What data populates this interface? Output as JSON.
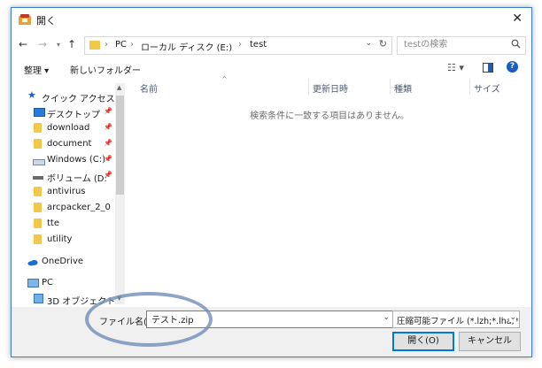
{
  "window": {
    "title": "開く",
    "close_icon": "close-icon"
  },
  "address": {
    "crumbs": [
      "PC",
      "ローカル ディスク (E:)",
      "test"
    ],
    "separator": "›"
  },
  "search": {
    "placeholder": "testの検索"
  },
  "toolbar": {
    "organize": "整理 ▾",
    "new_folder": "新しいフォルダー"
  },
  "sidebar": {
    "quick_access": "クイック アクセス",
    "items": [
      {
        "label": "デスクトップ",
        "pinned": true
      },
      {
        "label": "download",
        "pinned": true
      },
      {
        "label": "document",
        "pinned": true
      },
      {
        "label": "Windows (C:)",
        "pinned": true
      },
      {
        "label": "ボリューム (D:",
        "pinned": true
      },
      {
        "label": "antivirus"
      },
      {
        "label": "arcpacker_2_0"
      },
      {
        "label": "tte"
      },
      {
        "label": "utility"
      }
    ],
    "onedrive": "OneDrive",
    "pc": "PC",
    "objects3d": "3D オブジェクト"
  },
  "columns": {
    "name": "名前",
    "updated": "更新日時",
    "type": "種類",
    "size": "サイズ"
  },
  "empty_message": "検索条件に一致する項目はありません。",
  "bottom": {
    "filename_label": "ファイル名(N):",
    "filename_value": "テスト.zip",
    "filter": "圧縮可能ファイル (*.lzh;*.lha;*.zip",
    "open": "開く(O)",
    "cancel": "キャンセル"
  },
  "colors": {
    "accent": "#0078d7",
    "folder": "#f3c749",
    "highlight_ellipse": "#6f8fb8"
  }
}
